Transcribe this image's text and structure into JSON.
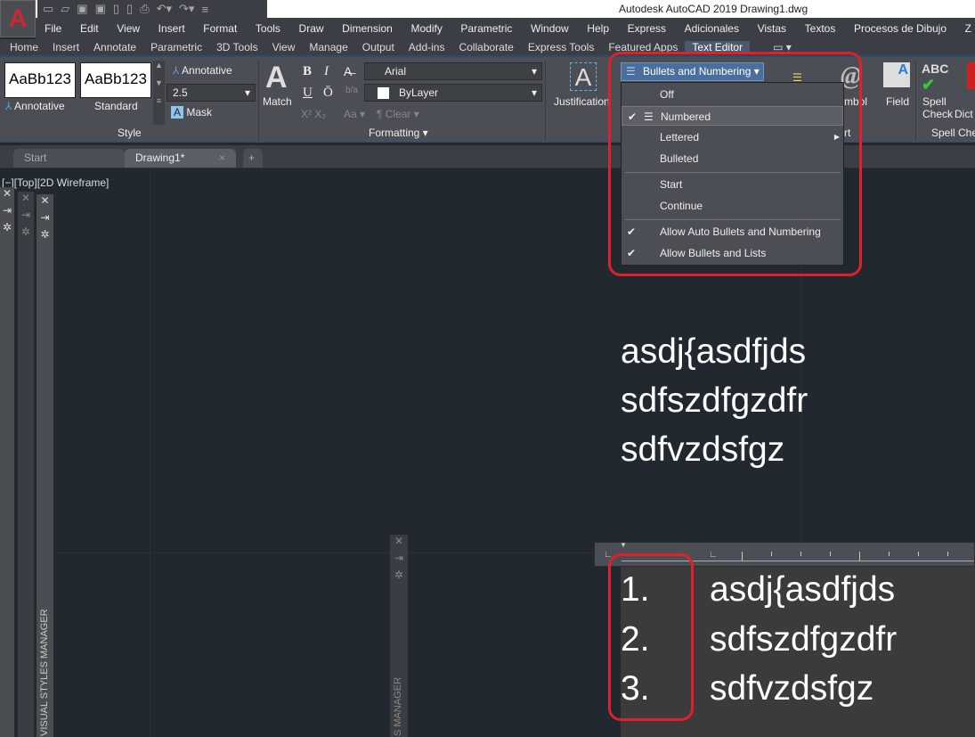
{
  "app": {
    "title": "Autodesk AutoCAD 2019    Drawing1.dwg",
    "logo": "A"
  },
  "menubar": [
    "File",
    "Edit",
    "View",
    "Insert",
    "Format",
    "Tools",
    "Draw",
    "Dimension",
    "Modify",
    "Parametric",
    "Window",
    "Help",
    "Express",
    "Adicionales",
    "Vistas",
    "Textos",
    "Procesos de Dibujo",
    "Z"
  ],
  "ribbon_tabs": [
    "Home",
    "Insert",
    "Annotate",
    "Parametric",
    "3D Tools",
    "View",
    "Manage",
    "Output",
    "Add-ins",
    "Collaborate",
    "Express Tools",
    "Featured Apps",
    "Text Editor"
  ],
  "active_ribbon_tab": "Text Editor",
  "style_panel": {
    "swatch1": "AaBb123",
    "swatch1_label": "Annotative",
    "swatch2": "AaBb123",
    "swatch2_label": "Standard",
    "annotative": "Annotative",
    "height": "2.5",
    "mask": "Mask",
    "label": "Style"
  },
  "formatting_panel": {
    "match": "Match",
    "bold": "B",
    "italic": "I",
    "underline": "U",
    "overline": "Ō",
    "font": "Arial",
    "color": "ByLayer",
    "clear": "Clear",
    "case": "Aa",
    "label": "Formatting ▾"
  },
  "paragraph": {
    "justification": "Justification"
  },
  "insert_panel": {
    "symbol": "Symbol",
    "field": "Field",
    "label": "rt"
  },
  "spell_panel": {
    "spell": "Spell",
    "check": "Check",
    "dict": "Dict",
    "label": "Spell Che",
    "abc": "ABC"
  },
  "bullets_button": "Bullets and Numbering",
  "bullets_menu": {
    "items": [
      {
        "label": "Off",
        "checked": false
      },
      {
        "label": "Numbered",
        "checked": true
      },
      {
        "label": "Lettered",
        "checked": false,
        "submenu": true
      },
      {
        "label": "Bulleted",
        "checked": false
      },
      {
        "label": "Start",
        "checked": false
      },
      {
        "label": "Continue",
        "checked": false
      },
      {
        "label": "Allow Auto Bullets and Numbering",
        "checked": true
      },
      {
        "label": "Allow Bullets and Lists",
        "checked": true
      }
    ]
  },
  "doc_tabs": [
    {
      "label": "Start"
    },
    {
      "label": "Drawing1*",
      "active": true
    }
  ],
  "viewport_label": "[−][Top][2D Wireframe]",
  "palette_names": [
    "VISUAL STYLES MANAGER",
    "S MANAGER"
  ],
  "canvas_text": [
    "asdj{asdfjds",
    "sdfszdfgzdfr",
    "sdfvzdsfgz"
  ],
  "editor_list": [
    {
      "num": "1.",
      "text": "asdj{asdfjds"
    },
    {
      "num": "2.",
      "text": "sdfszdfgzdfr"
    },
    {
      "num": "3.",
      "text": "sdfvzdsfgz"
    }
  ],
  "colors": {
    "highlight": "#e0202a",
    "accent": "#4a6f9c",
    "canvas": "#212830"
  }
}
